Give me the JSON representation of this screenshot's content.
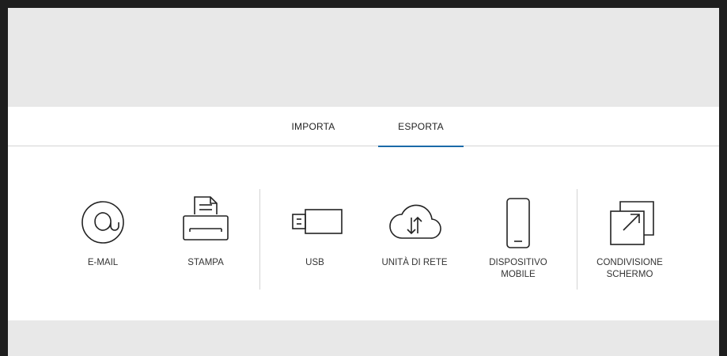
{
  "tabs": [
    {
      "label": "IMPORTA",
      "active": false
    },
    {
      "label": "ESPORTA",
      "active": true
    }
  ],
  "accent_color": "#1b6aa8",
  "options": [
    {
      "label": "E-MAIL",
      "icon": "email-at-icon"
    },
    {
      "label": "STAMPA",
      "icon": "printer-icon"
    },
    {
      "label": "USB",
      "icon": "usb-drive-icon"
    },
    {
      "label": "UNITÀ DI RETE",
      "icon": "network-cloud-icon"
    },
    {
      "label": "DISPOSITIVO\nMOBILE",
      "icon": "mobile-phone-icon"
    },
    {
      "label": "CONDIVISIONE\nSCHERMO",
      "icon": "screen-share-icon"
    }
  ]
}
